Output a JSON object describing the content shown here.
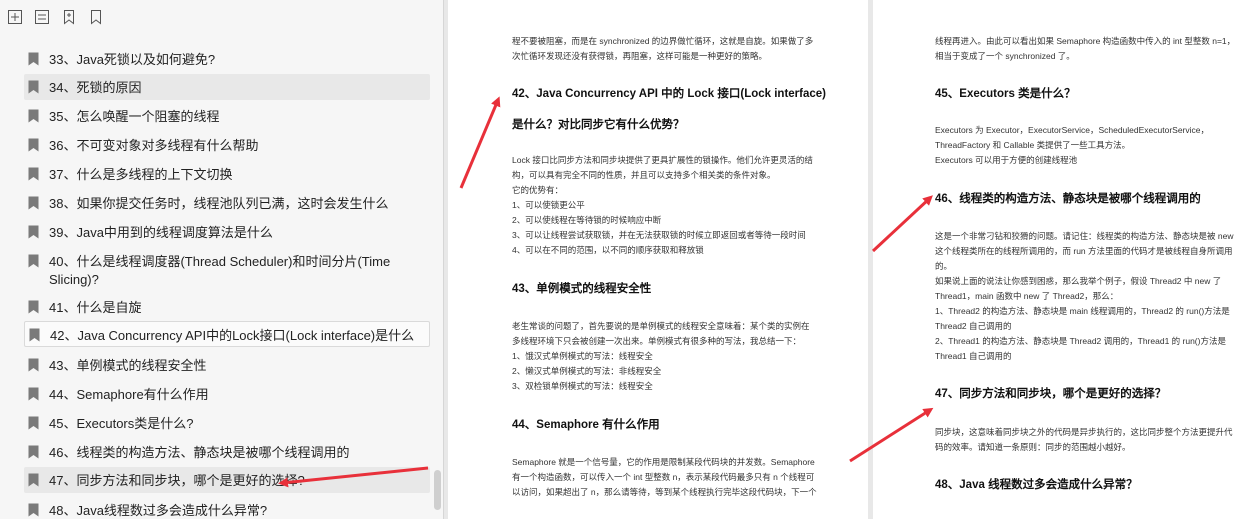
{
  "toolbar": {
    "icons": [
      "expand-all-icon",
      "collapse-all-icon",
      "add-bookmark-icon",
      "bookmark-icon"
    ]
  },
  "outline": {
    "items": [
      {
        "label": "33、Java死锁以及如何避免?"
      },
      {
        "label": "34、死锁的原因"
      },
      {
        "label": "35、怎么唤醒一个阻塞的线程"
      },
      {
        "label": "36、不可变对象对多线程有什么帮助"
      },
      {
        "label": "37、什么是多线程的上下文切换"
      },
      {
        "label": "38、如果你提交任务时，线程池队列已满，这时会发生什么"
      },
      {
        "label": "39、Java中用到的线程调度算法是什么"
      },
      {
        "label": "40、什么是线程调度器(Thread Scheduler)和时间分片(Time Slicing)?"
      },
      {
        "label": "41、什么是自旋"
      },
      {
        "label": "42、Java Concurrency API中的Lock接口(Lock interface)是什么"
      },
      {
        "label": "43、单例模式的线程安全性"
      },
      {
        "label": "44、Semaphore有什么作用"
      },
      {
        "label": "45、Executors类是什么?"
      },
      {
        "label": "46、线程类的构造方法、静态块是被哪个线程调用的"
      },
      {
        "label": "47、同步方法和同步块，哪个是更好的选择?"
      },
      {
        "label": "48、Java线程数过多会造成什么异常?"
      }
    ]
  },
  "page1": {
    "intro": [
      "程不要被阻塞，而是在 synchronized 的边界做忙循环，这就是自旋。如果做了多",
      "次忙循环发现还没有获得锁，再阻塞，这样可能是一种更好的策略。"
    ],
    "h42a": "42、Java Concurrency API 中的 Lock 接口(Lock interface)",
    "h42b": "是什么？对比同步它有什么优势？",
    "p42": [
      "Lock 接口比同步方法和同步块提供了更具扩展性的锁操作。他们允许更灵活的结",
      "构，可以具有完全不同的性质，并且可以支持多个相关类的条件对象。",
      "它的优势有：",
      "1、可以使锁更公平",
      "2、可以使线程在等待锁的时候响应中断",
      "3、可以让线程尝试获取锁，并在无法获取锁的时候立即返回或者等待一段时间",
      "4、可以在不同的范围，以不同的顺序获取和释放锁"
    ],
    "h43": "43、单例模式的线程安全性",
    "p43": [
      "老生常谈的问题了，首先要说的是单例模式的线程安全意味着：某个类的实例在",
      "多线程环境下只会被创建一次出来。单例模式有很多种的写法，我总结一下：",
      "1、饿汉式单例模式的写法：线程安全",
      "2、懒汉式单例模式的写法：非线程安全",
      "3、双检锁单例模式的写法：线程安全"
    ],
    "h44": "44、Semaphore 有什么作用",
    "p44": [
      "Semaphore 就是一个信号量，它的作用是限制某段代码块的并发数。Semaphore",
      "有一个构造函数，可以传入一个 int 型整数 n，表示某段代码最多只有 n 个线程可",
      "以访问，如果超出了 n，那么请等待，等到某个线程执行完毕这段代码块，下一个"
    ]
  },
  "page2": {
    "intro": [
      "线程再进入。由此可以看出如果 Semaphore 构造函数中传入的 int 型整数 n=1，",
      "相当于变成了一个 synchronized 了。"
    ],
    "h45": "45、Executors 类是什么？",
    "p45": [
      "Executors 为 Executor，ExecutorService，ScheduledExecutorService，",
      "ThreadFactory 和 Callable 类提供了一些工具方法。",
      "Executors 可以用于方便的创建线程池"
    ],
    "h46": "46、线程类的构造方法、静态块是被哪个线程调用的",
    "p46": [
      "这是一个非常刁钻和狡猾的问题。请记住：线程类的构造方法、静态块是被 new",
      "这个线程类所在的线程所调用的，而 run 方法里面的代码才是被线程自身所调用",
      "的。",
      "如果说上面的说法让你感到困惑，那么我举个例子，假设 Thread2 中 new 了",
      "Thread1，main 函数中 new 了 Thread2，那么：",
      "1、Thread2 的构造方法、静态块是 main 线程调用的，Thread2 的 run()方法是",
      "Thread2 自己调用的",
      "2、Thread1 的构造方法、静态块是 Thread2 调用的，Thread1 的 run()方法是",
      "Thread1 自己调用的"
    ],
    "h47": "47、同步方法和同步块，哪个是更好的选择？",
    "p47": [
      "同步块，这意味着同步块之外的代码是异步执行的，这比同步整个方法更提升代",
      "码的效率。请知道一条原则：同步的范围越小越好。"
    ],
    "h48": "48、Java 线程数过多会造成什么异常？"
  },
  "colors": {
    "arrow": "#e8303a",
    "sidebar_bg": "#f6f6f6",
    "selected_bg": "#e8e8e8"
  }
}
